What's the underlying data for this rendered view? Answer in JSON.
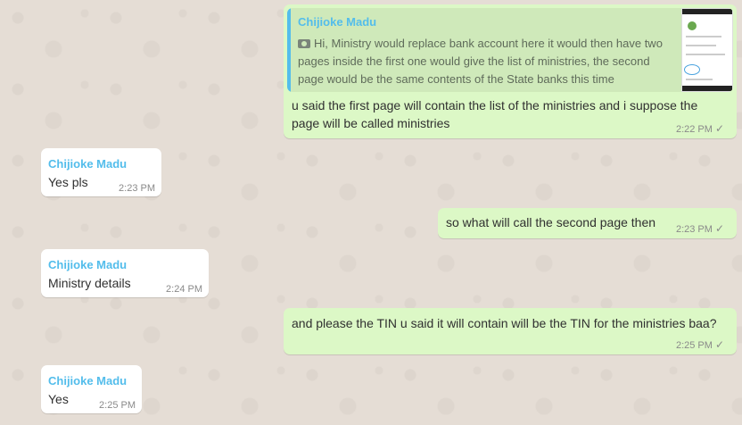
{
  "messages": [
    {
      "direction": "outgoing",
      "quoted": {
        "sender": "Chijioke Madu",
        "text": "Hi, Ministry would replace bank account here it would then have two pages inside the first one would give the list of ministries, the second page would be the same contents of the State banks this time"
      },
      "text": "u said the first page will contain the list of the ministries and i suppose the page will be called ministries",
      "time": "2:22 PM",
      "tick": "✓"
    },
    {
      "direction": "incoming",
      "sender": "Chijioke Madu",
      "text": "Yes pls",
      "time": "2:23 PM"
    },
    {
      "direction": "outgoing",
      "text": "so what will call the second page then",
      "time": "2:23 PM",
      "tick": "✓"
    },
    {
      "direction": "incoming",
      "sender": "Chijioke Madu",
      "text": "Ministry details",
      "time": "2:24 PM"
    },
    {
      "direction": "outgoing",
      "text": "and please the TIN u said it will contain will be the TIN for the ministries baa?",
      "time": "2:25 PM",
      "tick": "✓"
    },
    {
      "direction": "incoming",
      "sender": "Chijioke Madu",
      "text": "Yes",
      "time": "2:25 PM"
    }
  ],
  "icons": {
    "quote_media": "camera-icon",
    "sent_status": "check-icon"
  },
  "colors": {
    "outgoing": "#dcf8c6",
    "incoming": "#ffffff",
    "background": "#e5ddd5",
    "sender": "#53bdeb"
  }
}
